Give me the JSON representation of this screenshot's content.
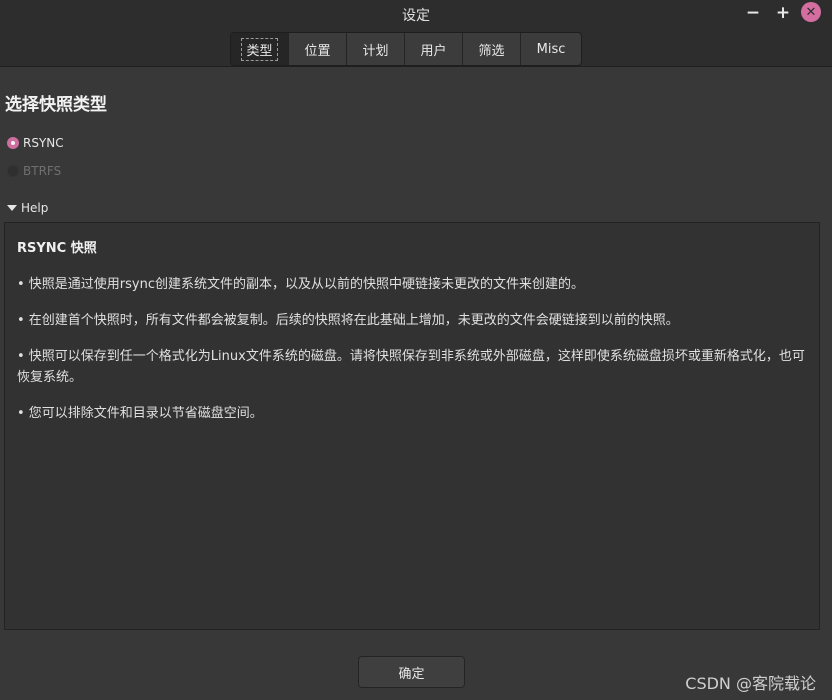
{
  "window": {
    "title": "设定",
    "minimize": "−",
    "maximize": "+",
    "close": "✕"
  },
  "tabs": [
    {
      "label": "类型",
      "active": true
    },
    {
      "label": "位置",
      "active": false
    },
    {
      "label": "计划",
      "active": false
    },
    {
      "label": "用户",
      "active": false
    },
    {
      "label": "筛选",
      "active": false
    },
    {
      "label": "Misc",
      "active": false
    }
  ],
  "main": {
    "section_title": "选择快照类型",
    "options": [
      {
        "label": "RSYNC",
        "selected": true,
        "enabled": true
      },
      {
        "label": "BTRFS",
        "selected": false,
        "enabled": false
      }
    ],
    "help_toggle": "Help",
    "help": {
      "heading": "RSYNC 快照",
      "paragraphs": [
        "• 快照是通过使用rsync创建系统文件的副本，以及从以前的快照中硬链接未更改的文件来创建的。",
        "• 在创建首个快照时，所有文件都会被复制。后续的快照将在此基础上增加，未更改的文件会硬链接到以前的快照。",
        "• 快照可以保存到任一个格式化为Linux文件系统的磁盘。请将快照保存到非系统或外部磁盘，这样即使系统磁盘损坏或重新格式化，也可恢复系统。",
        "• 您可以排除文件和目录以节省磁盘空间。"
      ]
    }
  },
  "footer": {
    "ok_label": "确定"
  },
  "watermark": "CSDN @客院载论",
  "colors": {
    "accent": "#cf6d9e",
    "background": "#383838",
    "header": "#2d2d2d"
  }
}
